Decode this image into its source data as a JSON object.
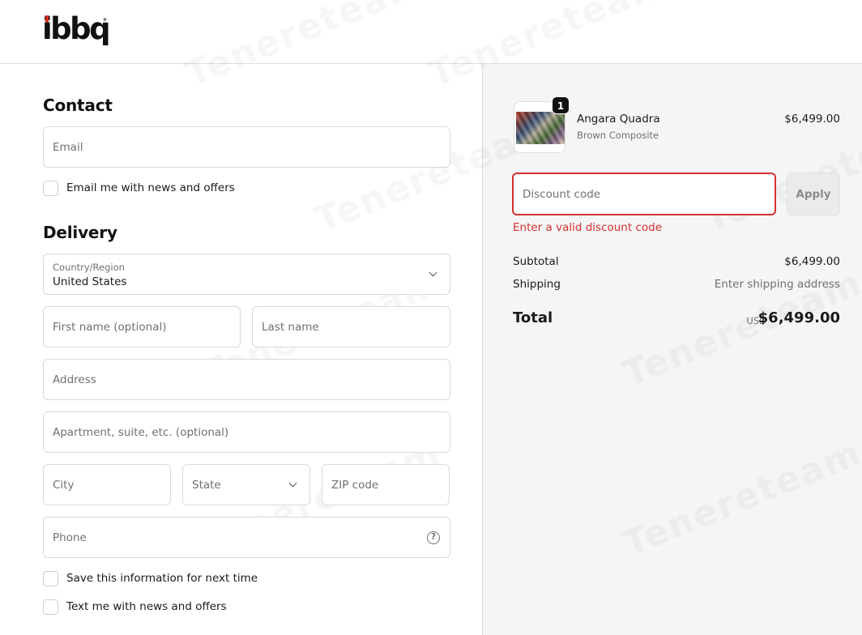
{
  "header": {
    "logo_text": "ibbq",
    "logo_tm": "®"
  },
  "contact": {
    "title": "Contact",
    "email_placeholder": "Email",
    "news_checkbox_label": "Email me with news and offers"
  },
  "delivery": {
    "title": "Delivery",
    "country_label": "Country/Region",
    "country_value": "United States",
    "first_name_placeholder": "First name (optional)",
    "last_name_placeholder": "Last name",
    "address_placeholder": "Address",
    "apartment_placeholder": "Apartment, suite, etc. (optional)",
    "city_placeholder": "City",
    "state_placeholder": "State",
    "zip_placeholder": "ZIP code",
    "phone_placeholder": "Phone",
    "help_icon": "?",
    "save_info_label": "Save this information for next time",
    "text_news_label": "Text me with news and offers"
  },
  "summary": {
    "product": {
      "name": "Angara Quadra",
      "variant": "Brown Composite",
      "price": "$6,499.00",
      "quantity": "1"
    },
    "discount_placeholder": "Discount code",
    "apply_label": "Apply",
    "discount_error": "Enter a valid discount code",
    "subtotal_label": "Subtotal",
    "subtotal_value": "$6,499.00",
    "shipping_label": "Shipping",
    "shipping_value": "Enter shipping address",
    "total_label": "Total",
    "currency": "USD",
    "total_value": "$6,499.00"
  },
  "watermark": {
    "text": "Tenereteam"
  },
  "colors": {
    "error": "#d43030",
    "panel_background": "#f5f5f5",
    "logo_accent": "#d42b1e"
  }
}
